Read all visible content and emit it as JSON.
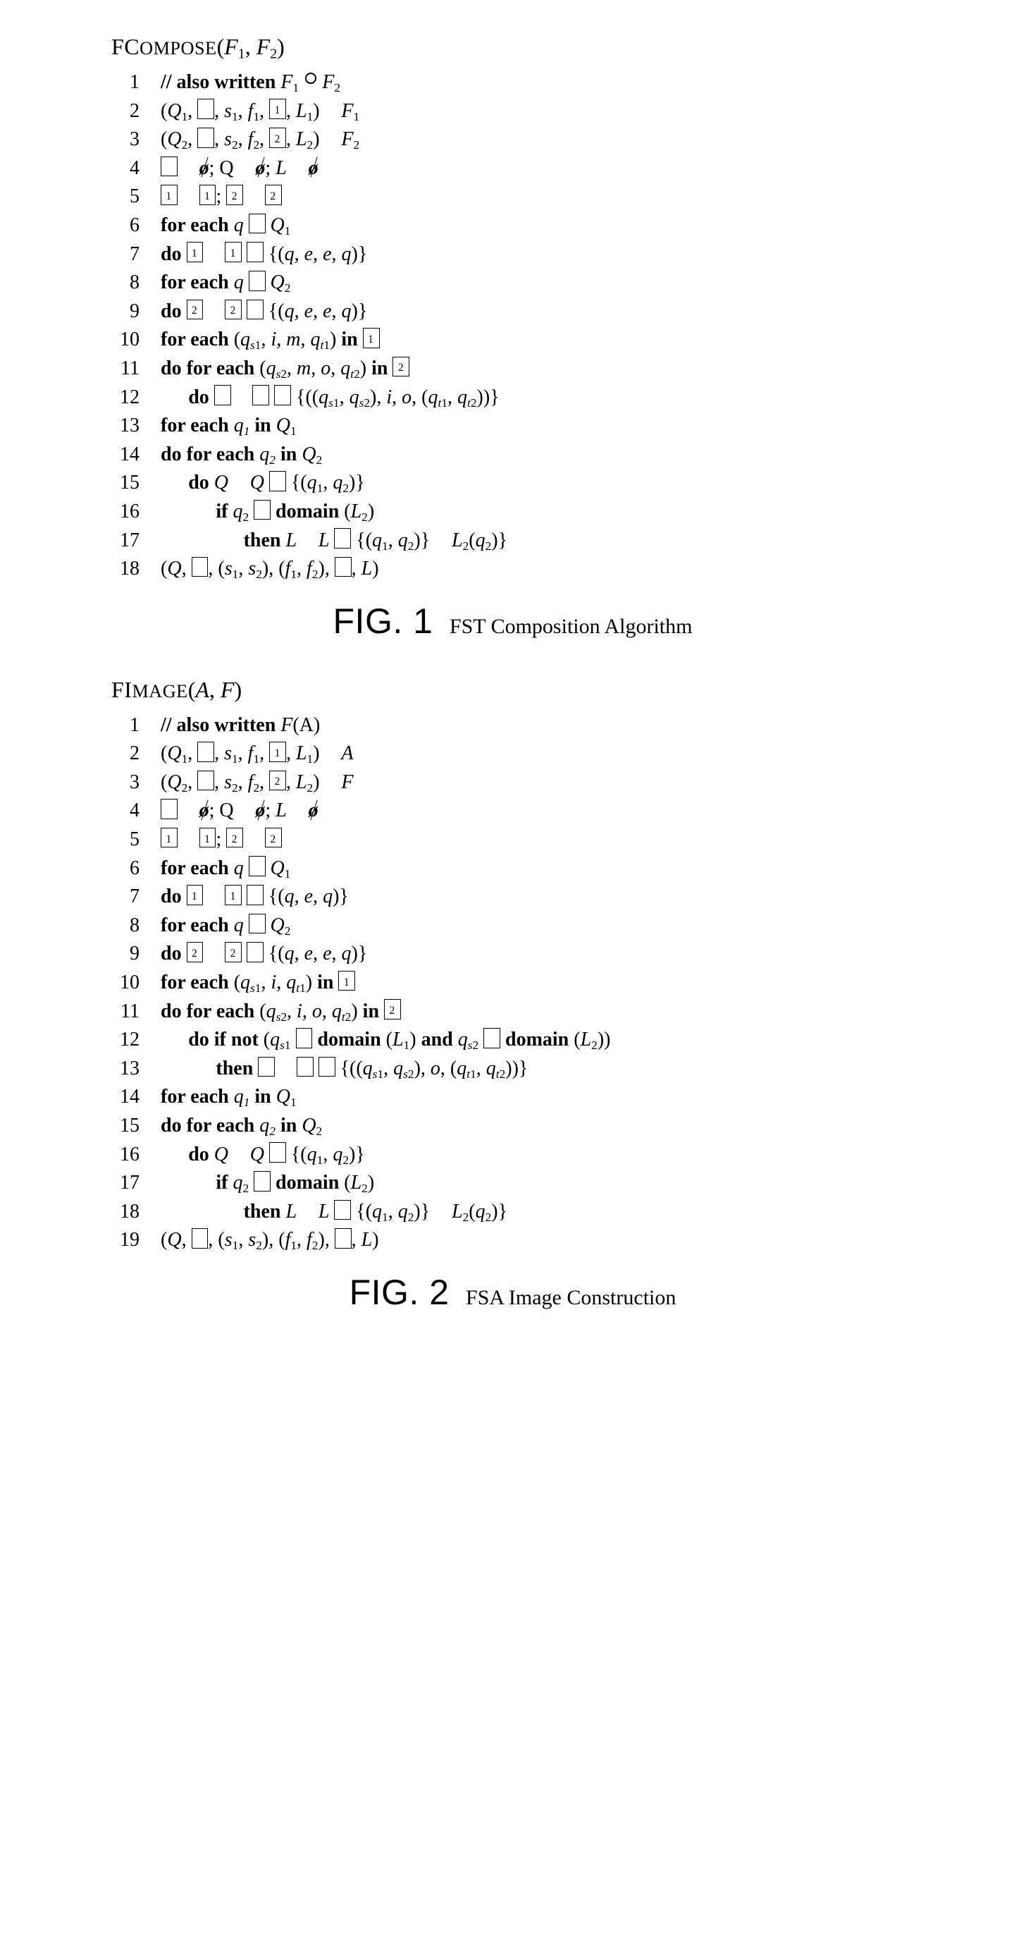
{
  "fig1": {
    "title_prefix": "FC",
    "title_rest": "OMPOSE",
    "title_args_a": "F",
    "title_args_b": "F",
    "caption_label": "FIG. 1",
    "caption_text": "FST Composition Algorithm"
  },
  "fig2": {
    "title_prefix": "FI",
    "title_rest": "MAGE",
    "title_args_a": "A",
    "title_args_b": "F",
    "caption_label": "FIG. 2",
    "caption_text": "FSA Image Construction"
  },
  "kw": {
    "for_each": "for each",
    "do": "do",
    "in": "in",
    "if": "if",
    "then": "then",
    "and": "and",
    "not": "not",
    "domain": "domain",
    "also_written": "// also written"
  },
  "ln": {
    "n1": "1",
    "n2": "2",
    "n3": "3",
    "n4": "4",
    "n5": "5",
    "n6": "6",
    "n7": "7",
    "n8": "8",
    "n9": "9",
    "n10": "10",
    "n11": "11",
    "n12": "12",
    "n13": "13",
    "n14": "14",
    "n15": "15",
    "n16": "16",
    "n17": "17",
    "n18": "18",
    "n19": "19"
  },
  "sym": {
    "Q": "Q",
    "L": "L",
    "s": "s",
    "f": "f",
    "q": "q",
    "i": "i",
    "m": "m",
    "o": "o",
    "e": "e",
    "A": "A",
    "F": "F"
  }
}
